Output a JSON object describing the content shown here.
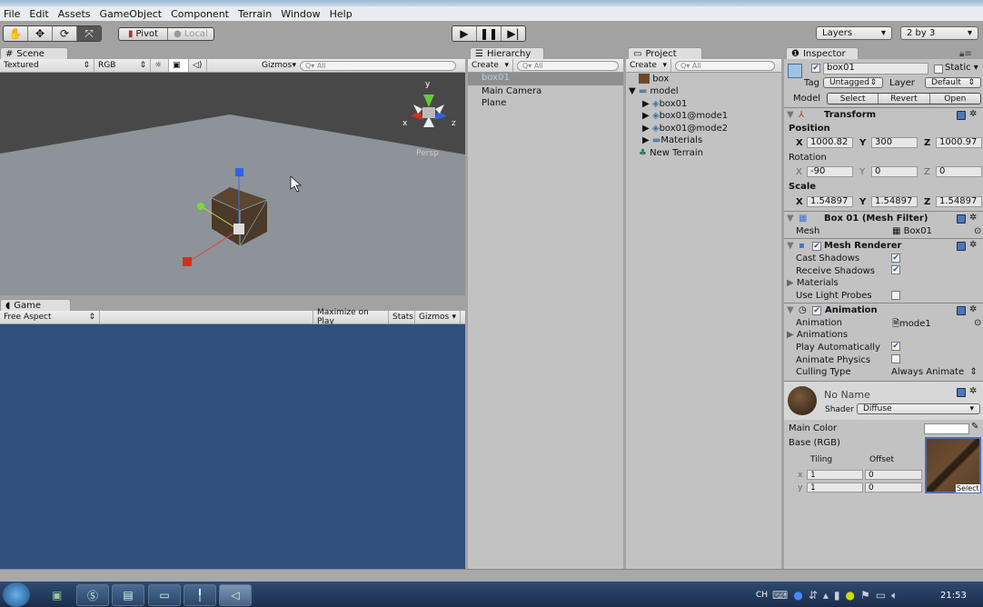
{
  "menu": [
    "File",
    "Edit",
    "Assets",
    "GameObject",
    "Component",
    "Terrain",
    "Window",
    "Help"
  ],
  "toolbar": {
    "transform_tools": [
      "hand",
      "move",
      "rotate",
      "scale"
    ],
    "pivot": "Pivot",
    "local": "Local",
    "layers": "Layers",
    "layout": "2 by 3"
  },
  "scene": {
    "tab": "Scene",
    "render_mode": "Textured",
    "channel": "RGB",
    "gizmos": "Gizmos",
    "search": "All",
    "persp": "Persp",
    "axis_labels": {
      "x": "x",
      "y": "y",
      "z": "z"
    }
  },
  "game": {
    "tab": "Game",
    "aspect": "Free Aspect",
    "maximize": "Maximize on Play",
    "stats": "Stats",
    "gizmos": "Gizmos",
    "background": "#2f4f7d"
  },
  "hierarchy": {
    "tab": "Hierarchy",
    "create": "Create",
    "search": "All",
    "items": [
      "box01",
      "Main Camera",
      "Plane"
    ],
    "selected": "box01"
  },
  "project": {
    "tab": "Project",
    "create": "Create",
    "search": "All",
    "items": [
      {
        "label": "box"
      },
      {
        "label": "model"
      },
      {
        "label": "box01"
      },
      {
        "label": "box01@mode1"
      },
      {
        "label": "box01@mode2"
      },
      {
        "label": "Materials"
      },
      {
        "label": "New Terrain"
      }
    ]
  },
  "inspector": {
    "tab": "Inspector",
    "name": "box01",
    "static": "Static",
    "tag_label": "Tag",
    "tag": "Untagged",
    "layer_label": "Layer",
    "layer": "Default",
    "model_label": "Model",
    "select": "Select",
    "revert": "Revert",
    "open": "Open",
    "transform": {
      "title": "Transform",
      "position": "Position",
      "rotation": "Rotation",
      "scale": "Scale",
      "pos": [
        "1000.82",
        "300",
        "1000.97"
      ],
      "rot": [
        "-90",
        "0",
        "0"
      ],
      "scl": [
        "1.54897",
        "1.54897",
        "1.54897"
      ],
      "x": "X",
      "y": "Y",
      "z": "Z"
    },
    "mesh_filter": {
      "title": "Box 01 (Mesh Filter)",
      "mesh_label": "Mesh",
      "mesh": "Box01"
    },
    "mesh_renderer": {
      "title": "Mesh Renderer",
      "cast": "Cast Shadows",
      "receive": "Receive Shadows",
      "materials": "Materials",
      "probes": "Use Light Probes"
    },
    "animation": {
      "title": "Animation",
      "anim_label": "Animation",
      "anim": "mode1",
      "anims": "Animations",
      "play": "Play Automatically",
      "physics": "Animate Physics",
      "culling_label": "Culling Type",
      "culling": "Always Animate"
    },
    "material": {
      "name": "No Name",
      "shader_label": "Shader",
      "shader": "Diffuse",
      "main_color": "Main Color",
      "base": "Base (RGB)",
      "tiling": "Tiling",
      "offset": "Offset",
      "x": "x",
      "y": "y",
      "tx": "1",
      "ty": "1",
      "ox": "0",
      "oy": "0",
      "select": "Select"
    }
  },
  "taskbar": {
    "ime": "CH",
    "clock": "21:53"
  }
}
